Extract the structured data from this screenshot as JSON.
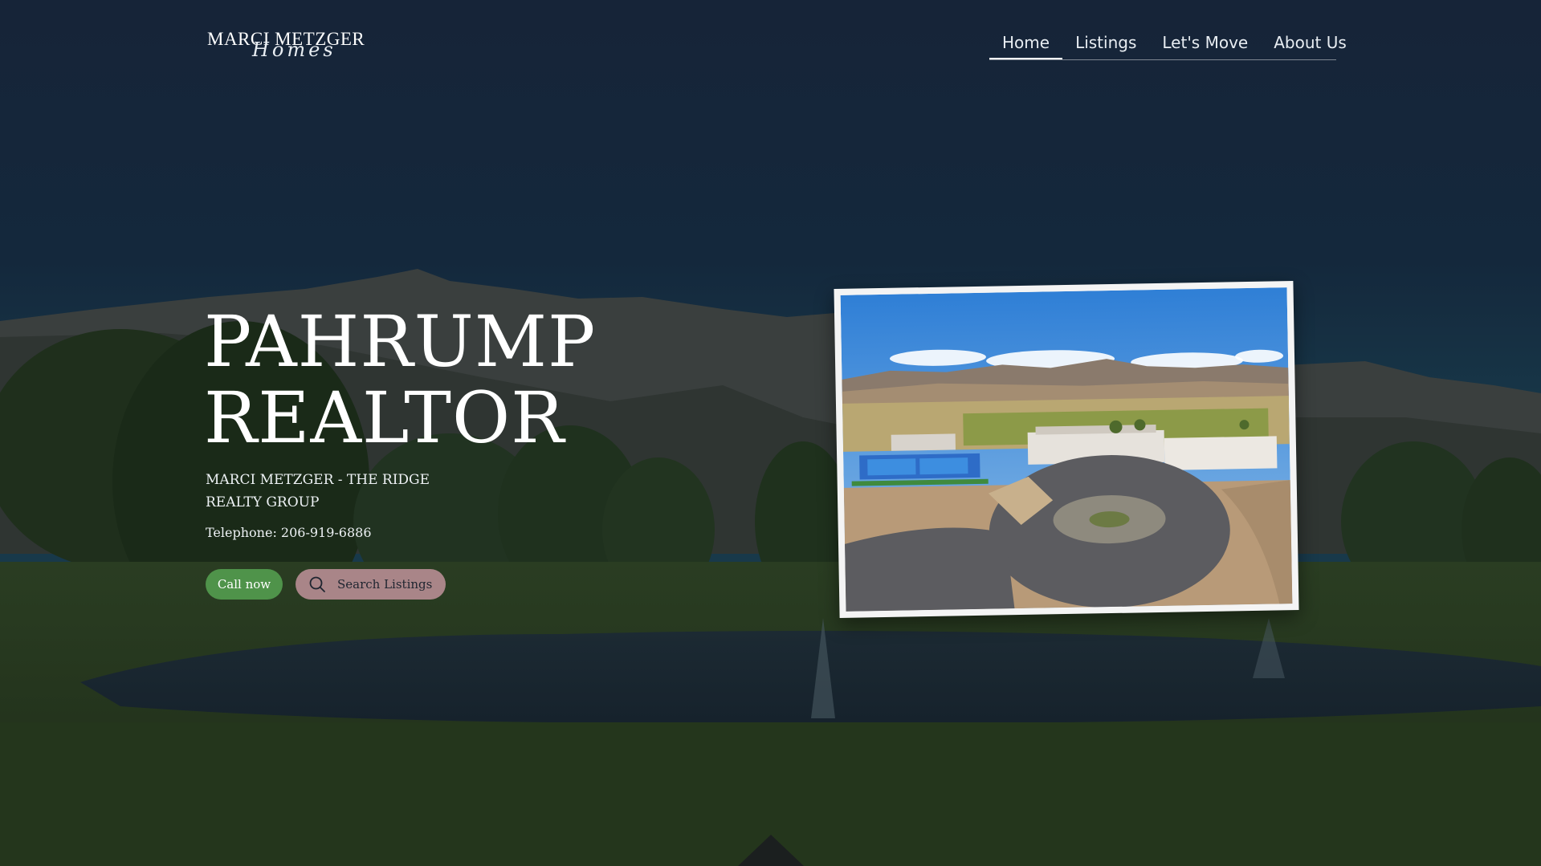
{
  "header": {
    "logo": {
      "main": "MARCI METZGER",
      "script": "Homes"
    },
    "nav": [
      {
        "label": "Home",
        "active": true
      },
      {
        "label": "Listings",
        "active": false
      },
      {
        "label": "Let's Move",
        "active": false
      },
      {
        "label": "About Us",
        "active": false
      }
    ]
  },
  "hero": {
    "title_line1": "PAHRUMP",
    "title_line2": "REALTOR",
    "subtitle_line1": "MARCI METZGER - THE RIDGE",
    "subtitle_line2": "REALTY GROUP",
    "phone": "Telephone: 206-919-6886",
    "call_button": "Call now",
    "search_button": "Search Listings",
    "search_icon": "search-icon"
  },
  "colors": {
    "call_button": "#4f934a",
    "search_button": "#a98588",
    "sky_overlay": "#15263a"
  }
}
